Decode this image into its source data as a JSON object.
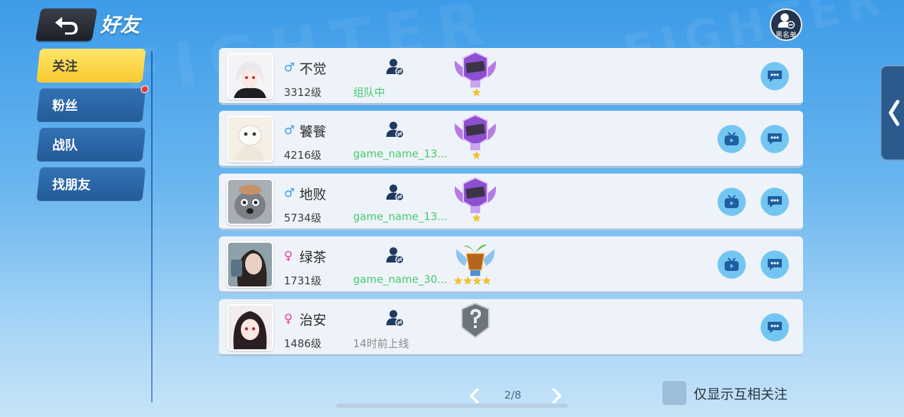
{
  "header": {
    "title": "好友",
    "blacklist_label": "黑名单"
  },
  "sidebar": {
    "tabs": [
      {
        "label": "关注",
        "active": true,
        "badge": false
      },
      {
        "label": "粉丝",
        "active": false,
        "badge": true
      },
      {
        "label": "战队",
        "active": false,
        "badge": false
      },
      {
        "label": "找朋友",
        "active": false,
        "badge": false
      }
    ]
  },
  "friends": [
    {
      "gender": "male",
      "gender_symbol": "♂",
      "name": "不觉",
      "level": "3312级",
      "status": "组队中",
      "online": true,
      "rank": "purple",
      "stars": "★",
      "watch": false
    },
    {
      "gender": "male",
      "gender_symbol": "♂",
      "name": "饕餮",
      "level": "4216级",
      "status": "game_name_13...",
      "online": true,
      "rank": "purple",
      "stars": "★",
      "watch": true
    },
    {
      "gender": "male",
      "gender_symbol": "♂",
      "name": "地败",
      "level": "5734级",
      "status": "game_name_13...",
      "online": true,
      "rank": "purple",
      "stars": "★",
      "watch": true
    },
    {
      "gender": "female",
      "gender_symbol": "♀",
      "name": "绿茶",
      "level": "1731级",
      "status": "game_name_30...",
      "online": true,
      "rank": "blue",
      "stars": "★★★★",
      "watch": true
    },
    {
      "gender": "female",
      "gender_symbol": "♀",
      "name": "治安",
      "level": "1486级",
      "status": "14时前上线",
      "online": false,
      "rank": "unknown",
      "stars": "",
      "watch": false
    }
  ],
  "pagination": {
    "current": "2/8"
  },
  "filter": {
    "mutual_label": "仅显示互相关注",
    "checked": false
  },
  "colors": {
    "accent_yellow": "#f8c930",
    "online_green": "#47c96e",
    "tab_blue": "#235b98"
  }
}
